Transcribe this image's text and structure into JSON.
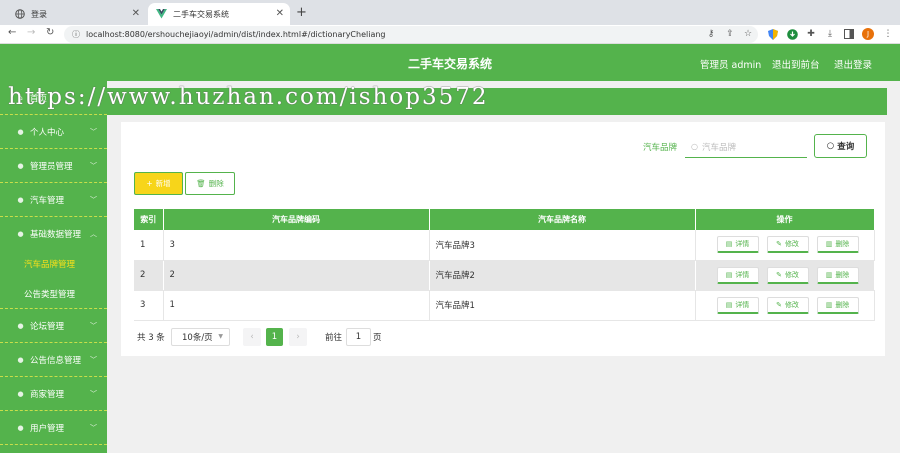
{
  "browser": {
    "tabs": [
      {
        "title": "登录"
      },
      {
        "title": "二手车交易系统"
      }
    ],
    "new_tab": "+",
    "url": "localhost:8080/ershouchejiaoyi/admin/dist/index.html#/dictionaryCheliang",
    "profile_initial": "J",
    "colors": {
      "profile": "#e8710a"
    }
  },
  "header": {
    "title": "二手车交易系统",
    "user": "管理员 admin",
    "to_front": "退出到前台",
    "logout": "退出登录"
  },
  "sidebar": {
    "items": [
      {
        "label": "首页",
        "icon": "home-icon"
      },
      {
        "label": "个人中心",
        "icon": "user-icon"
      },
      {
        "label": "管理员管理",
        "icon": "user-icon"
      },
      {
        "label": "汽车管理",
        "icon": "user-icon"
      },
      {
        "label": "基础数据管理",
        "icon": "user-icon",
        "expanded": true,
        "children": [
          {
            "label": "汽车品牌管理",
            "active": true
          },
          {
            "label": "公告类型管理"
          }
        ]
      },
      {
        "label": "论坛管理",
        "icon": "user-icon"
      },
      {
        "label": "公告信息管理",
        "icon": "user-icon"
      },
      {
        "label": "商家管理",
        "icon": "user-icon"
      },
      {
        "label": "用户管理",
        "icon": "user-icon"
      }
    ]
  },
  "watermark": "https://www.huzhan.com/ishop3572",
  "search": {
    "label": "汽车品牌",
    "placeholder": "汽车品牌",
    "button": "查询"
  },
  "toolbar": {
    "add": "新增",
    "delete": "删除"
  },
  "table": {
    "columns": [
      "索引",
      "汽车品牌编码",
      "汽车品牌名称",
      "操作"
    ],
    "rows": [
      {
        "index": "1",
        "code": "3",
        "name": "汽车品牌3"
      },
      {
        "index": "2",
        "code": "2",
        "name": "汽车品牌2"
      },
      {
        "index": "3",
        "code": "1",
        "name": "汽车品牌1"
      }
    ],
    "actions": {
      "detail": "详情",
      "edit": "修改",
      "delete": "删除"
    }
  },
  "pagination": {
    "total": "共 3 条",
    "page_size": "10条/页",
    "current": "1",
    "goto_prefix": "前往",
    "goto_value": "1",
    "goto_suffix": "页"
  },
  "colors": {
    "primary": "#54b34c",
    "sidebar_active": "#f7e01a",
    "add_button": "#f7d51a"
  }
}
